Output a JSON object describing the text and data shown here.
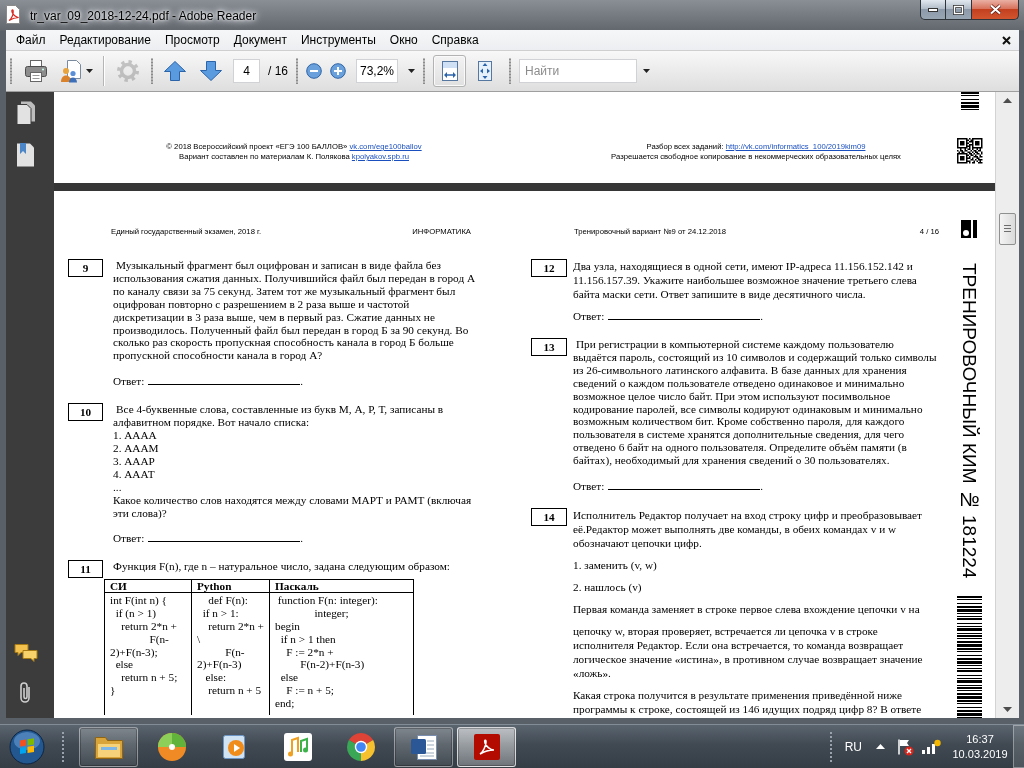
{
  "window": {
    "title": "tr_var_09_2018-12-24.pdf - Adobe Reader"
  },
  "menu": [
    "Файл",
    "Редактирование",
    "Просмотр",
    "Документ",
    "Инструменты",
    "Окно",
    "Справка"
  ],
  "toolbar": {
    "tool_groups": [
      [
        {
          "kind": "print",
          "disabled": false
        },
        {
          "kind": "share",
          "disabled": false
        }
      ],
      [
        {
          "kind": "settings",
          "disabled": true
        }
      ],
      [
        {
          "kind": "previous-page",
          "disabled": false
        },
        {
          "kind": "next-page",
          "disabled": false
        }
      ]
    ],
    "page_field": "4",
    "page_count": "/ 16",
    "zoom_field": "73,2%",
    "view_modes": [
      {
        "kind": "fit-width",
        "selected": true
      },
      {
        "kind": "fit-page",
        "selected": false
      }
    ],
    "search": {
      "placeholder": "Найти"
    }
  },
  "previous_page": {
    "credits": [
      {
        "text": "© 2018 Всероссийский проект «ЕГЭ 100 БАЛЛОВ»",
        "link": "vk.com/ege100ballov"
      },
      {
        "text": "Вариант составлен по материалам К. Полякова",
        "link": "kpolyakov.spb.ru"
      }
    ],
    "notes": [
      {
        "text": "Разбор всех заданий:",
        "link": "http://vk.com/informatics_100/2019kim09"
      },
      {
        "text": "Разрешается свободное копирование в некоммерческих образовательных целях"
      }
    ]
  },
  "page": {
    "header": {
      "exam": "Единый государственный экзамен, 2018 г.",
      "subject": "ИНФОРМАТИКА",
      "variant": "Тренировочный вариант №9 от 24.12.2018",
      "page": "4 / 16"
    },
    "side_title": "ТРЕНИРОВОЧНЫЙ КИМ № 181224",
    "columns": [
      {
        "questions": [
          {
            "number": "9",
            "blocks": [
              {
                "kind": "indented",
                "text": "Музыкальный фрагмент был оцифрован и записан в виде файла без использования сжатия данных. Получившийся файл был передан в город А по каналу связи за 75 секунд. Затем тот же музыкальный фрагмент был оцифрован повторно с разрешением в 2 раза выше и частотой дискретизации в 3 раза выше, чем в первый раз. Сжатие данных не производилось. Полученный файл был передан в город Б за 90 секунд. Во сколько раз скорость пропускная способность канала в город Б больше пропускной способности канала в город А?"
              }
            ],
            "answer": {
              "label": "Ответ:",
              "end": "."
            }
          },
          {
            "number": "10",
            "blocks": [
              {
                "kind": "indented",
                "text": "Все 4-буквенные слова, составленные из букв М, А, Р, Т, записаны в алфавитном порядке. Вот начало списка:"
              },
              {
                "kind": "lines",
                "lines": [
                  "1. АААА",
                  "2. АААМ",
                  "3. АААР",
                  "4. АААТ",
                  "..."
                ]
              },
              {
                "kind": "text",
                "text": "Какое количество слов находятся между словами МАРТ и РАМТ (включая эти слова)?"
              }
            ],
            "answer": {
              "label": "Ответ:",
              "end": "."
            }
          },
          {
            "number": "11",
            "blocks": [
              {
                "kind": "text",
                "text": "Функция F(n), где n – натуральное число, задана следующим образом:"
              },
              {
                "kind": "table",
                "columns": [
                  "СИ",
                  "Python",
                  "Паскаль"
                ],
                "cells": [
                  "int F(int n) {\n  if (n > 1)\n    return 2*n +\n              F(n-\n2)+F(n-3);\n  else\n    return n + 5;\n}",
                  "    def F(n):\n  if n > 1:\n    return 2*n +\n\\\n          F(n-\n2)+F(n-3)\n   else:\n    return n + 5",
                  " function F(n: integer):\n              integer;\nbegin\n  if n > 1 then\n    F := 2*n +\n         F(n-2)+F(n-3)\n  else\n    F := n + 5;\nend;"
                ]
              }
            ]
          }
        ]
      },
      {
        "questions": [
          {
            "number": "12",
            "blocks": [
              {
                "kind": "spaced",
                "text": "Два узла, находящиеся в одной сети, имеют IP-адреса 11.156.152.142 и 11.156.157.39. Укажите наибольшее возможное значение третьего слева байта маски сети. Ответ запишите в виде десятичного числа."
              }
            ],
            "answer": {
              "label": "Ответ:",
              "end": "."
            }
          },
          {
            "number": "13",
            "blocks": [
              {
                "kind": "indented",
                "text": "При регистрации в компьютерной системе каждому пользователю выдаётся пароль, состоящий из 10 символов и содержащий только символы из 26-символьного латинского алфавита. В базе данных для хранения сведений о каждом пользователе отведено одинаковое и минимально возможное целое число байт. При этом используют посимвольное кодирование паролей, все символы кодируют одинаковым и минимально возможным количеством бит. Кроме собственно пароля, для каждого пользователя в системе хранятся дополнительные сведения, для чего отведено 6 байт на одного пользователя. Определите объём памяти (в байтах), необходимый для хранения сведений о 30 пользователях."
              }
            ],
            "answer": {
              "label": "Ответ:",
              "end": "."
            }
          },
          {
            "number": "14",
            "blocks": [
              {
                "kind": "spaced",
                "text": "Исполнитель Редактор получает на вход строку цифр и преобразовывает её.Редактор может выполнять две команды, в обеих командах v и w обозначают цепочки цифр."
              },
              {
                "kind": "spaced",
                "text": "1. заменить (v, w)"
              },
              {
                "kind": "spaced",
                "text": "2. нашлось (v)"
              },
              {
                "kind": "spaced",
                "text": "Первая команда заменяет в строке первое слева вхождение цепочки v на"
              },
              {
                "kind": "spaced",
                "text": "цепочку w, вторая проверяет, встречается ли цепочка v в строке исполнителя Редактор. Если она встречается, то команда возвращает логическое значение «истина», в противном случае возвращает значение «ложь»."
              },
              {
                "kind": "spaced",
                "text": "Какая строка получится в результате применения приведённой ниже программы к строке, состоящей из 146 идущих подряд цифр 8? В ответе"
              }
            ]
          }
        ]
      }
    ]
  },
  "taskbar": {
    "apps": [
      {
        "kind": "folder",
        "running": true,
        "selected": false
      },
      {
        "kind": "disc",
        "running": false,
        "selected": false
      },
      {
        "kind": "media",
        "running": false,
        "selected": false
      },
      {
        "kind": "music",
        "running": false,
        "selected": false
      },
      {
        "kind": "browser",
        "running": false,
        "selected": false
      },
      {
        "kind": "document",
        "running": true,
        "selected": false
      },
      {
        "kind": "pdf",
        "running": true,
        "selected": true
      }
    ],
    "language": "RU",
    "time": "16:37",
    "date": "10.03.2019"
  }
}
